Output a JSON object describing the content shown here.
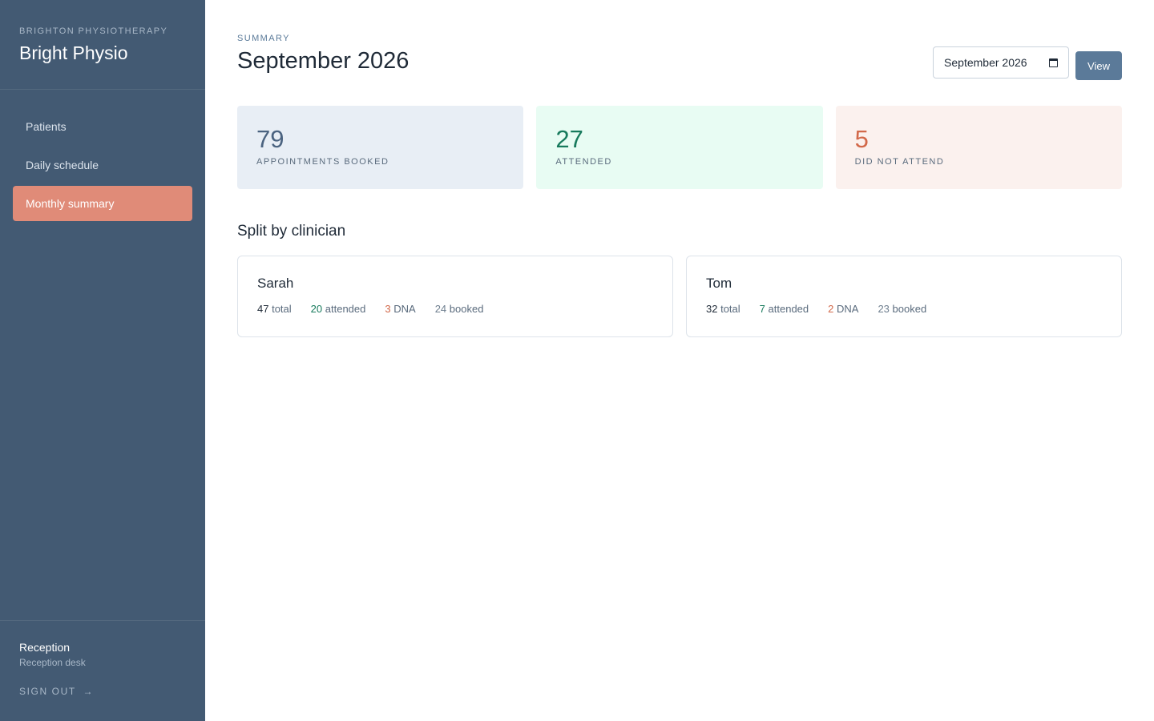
{
  "sidebar": {
    "brand_sub": "Brighton Physiotherapy",
    "brand_name": "Bright Physio",
    "nav": [
      {
        "label": "Patients"
      },
      {
        "label": "Daily schedule"
      },
      {
        "label": "Monthly summary",
        "active": true
      }
    ],
    "user": {
      "name": "Reception",
      "role": "Reception desk"
    },
    "signout_label": "Sign out",
    "signout_arrow": "→"
  },
  "header": {
    "eyebrow": "Summary",
    "title": "September 2026",
    "month_input_value": "September 2026",
    "view_button": "View"
  },
  "stats": {
    "booked": {
      "value": "79",
      "label": "Appointments booked"
    },
    "attended": {
      "value": "27",
      "label": "Attended"
    },
    "dna": {
      "value": "5",
      "label": "Did not attend"
    }
  },
  "section_title": "Split by clinician",
  "clinicians": [
    {
      "name": "Sarah",
      "total": "47",
      "total_label": "total",
      "attended": "20",
      "attended_label": "attended",
      "dna": "3",
      "dna_label": "DNA",
      "booked": "24",
      "booked_label": "booked"
    },
    {
      "name": "Tom",
      "total": "32",
      "total_label": "total",
      "attended": "7",
      "attended_label": "attended",
      "dna": "2",
      "dna_label": "DNA",
      "booked": "23",
      "booked_label": "booked"
    }
  ],
  "colors": {
    "sidebar_bg": "#435a73",
    "active_nav": "#e08b78",
    "accent_button": "#5b7a99",
    "attended": "#177a5c",
    "dna": "#d2694a"
  },
  "icons": {
    "calendar": "calendar-icon",
    "arrow": "arrow-right-icon"
  }
}
